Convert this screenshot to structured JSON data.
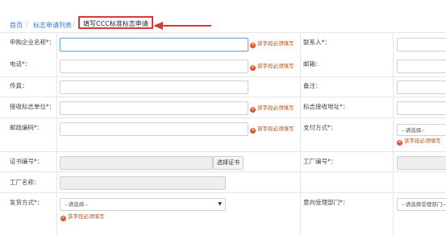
{
  "breadcrumb": {
    "home": "首页",
    "sep": "/",
    "list": "标志申请列表",
    "current": "填写CCC标准标志申请"
  },
  "required_hint": "该字段必须填写",
  "req_icon": "x-circle-icon",
  "colors": {
    "accent": "#3a77c7",
    "highlight": "#d43a3a",
    "required": "#e1522a"
  },
  "form": {
    "company_label": "申购企业名称*：",
    "contact_label": "联系人*：",
    "phone_label": "电话*：",
    "email_label": "邮箱：",
    "fax_label": "传真：",
    "remark_label": "备注：",
    "receiver_unit_label": "接收标志单位*：",
    "receiver_address_label": "标志接收地址*：",
    "postcode_label": "邮政编码*：",
    "payment_label": "支付方式*：",
    "payment_value": "--请选择--",
    "cert_label": "证书编号*：",
    "select_cert_button": "选择证书",
    "factory_no_label": "工厂编号*：",
    "factory_name_label": "工厂名称：",
    "shipping_label": "发货方式*：",
    "shipping_value": "--请选择--",
    "dept_label": "意向受理部门*：",
    "dept_value": "--请选择受理部门--"
  }
}
